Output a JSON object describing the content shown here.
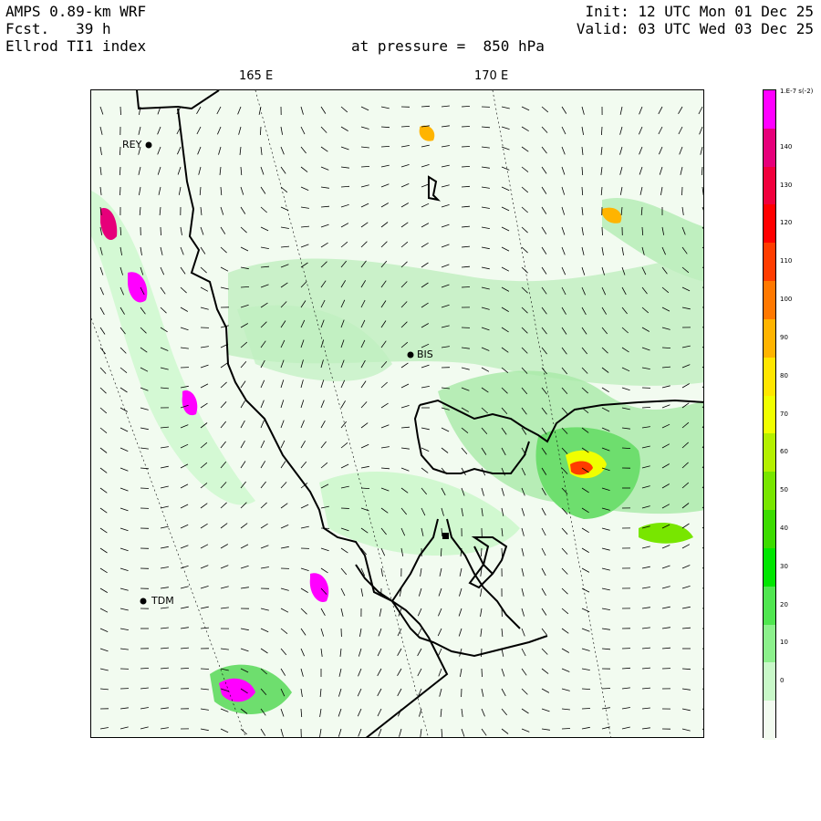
{
  "header": {
    "line1_left": "AMPS 0.89-km WRF",
    "line2_left": "Fcst.   39 h",
    "line3_left": "Ellrod TI1 index",
    "line1_right": "Init: 12 UTC Mon 01 Dec 25",
    "line2_right": "Valid: 03 UTC Wed 03 Dec 25",
    "pressure": "at pressure =  850 hPa"
  },
  "longitudes": [
    "165 E",
    "170 E"
  ],
  "stations": [
    {
      "label": "REY"
    },
    {
      "label": "BIS"
    },
    {
      "label": "TDM"
    }
  ],
  "colorbar": {
    "unit_label": "1.E-7 s(-2)",
    "levels": [
      "140",
      "130",
      "120",
      "110",
      "100",
      "90",
      "80",
      "70",
      "60",
      "50",
      "40",
      "30",
      "20",
      "10",
      "0"
    ],
    "colors": [
      "#ff00ff",
      "#e6007a",
      "#f0003c",
      "#ff0000",
      "#ff3c00",
      "#ff7800",
      "#ffb400",
      "#ffe600",
      "#f0ff00",
      "#b4f000",
      "#78e600",
      "#3cdc00",
      "#00e600",
      "#50e650",
      "#8cf08c",
      "#c8f8c8",
      "#f2fbf0"
    ]
  }
}
